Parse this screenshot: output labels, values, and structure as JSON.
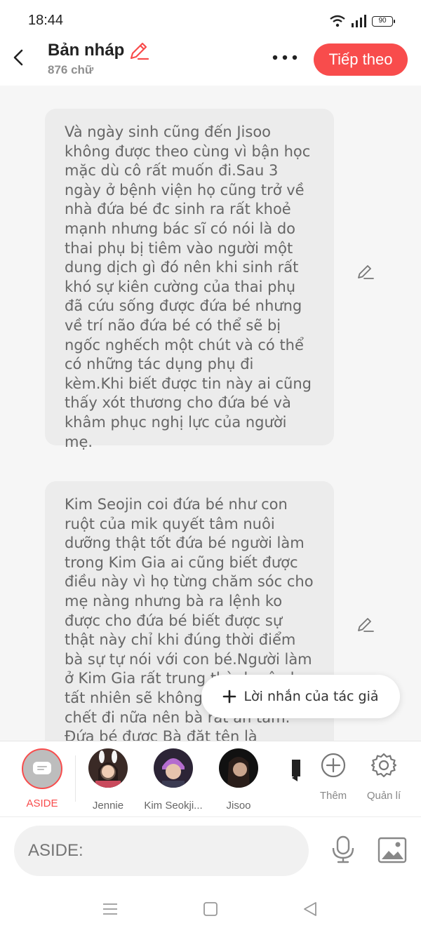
{
  "status_bar": {
    "time": "18:44",
    "battery": "90"
  },
  "header": {
    "title": "Bản nháp",
    "word_count": "876 chữ",
    "next_label": "Tiếp theo"
  },
  "content": {
    "paragraphs": [
      "Và ngày sinh cũng đến Jisoo không được  theo cùng vì bận học mặc dù cô rất muốn đi.Sau 3 ngày ở bệnh viện họ cũng trở về nhà đứa bé đc sinh ra rất khoẻ mạnh nhưng bác sĩ có nói là do thai phụ bị tiêm vào người một dung dịch gì đó nên khi sinh rất khó sự kiên cường của thai phụ đã cứu sống được đứa bé nhưng về trí não đứa bé có thể sẽ bị ngốc nghếch một chút và có thể có những tác dụng phụ đi kèm.Khi biết được tin này ai cũng thấy xót thương cho đứa bé và khâm phục nghị lực của người mẹ.",
      "Kim Seojin coi đứa bé như con ruột của mik quyết tâm nuôi dưỡng thật tốt đứa bé người làm trong Kim Gia ai cũng biết được điều này vì họ từng chăm sóc cho mẹ nàng nhưng bà ra lệnh ko được cho đứa bé biết được sự thật này chỉ khi đúng thời điểm bà sự tự nói với con bé.Người làm ở Kim Gia rất trung thành nên họ tất nhiên sẽ không nói ra dù có chết đi nữa nên bà rất an tâm. Đứa bé được Bà đặt tên là"
    ],
    "author_note_label": "Lời nhắn của tác giả"
  },
  "characters": [
    {
      "name": "ASIDE",
      "selected": true
    },
    {
      "name": "Jennie",
      "selected": false
    },
    {
      "name": "Kim Seokji...",
      "selected": false
    },
    {
      "name": "Jisoo",
      "selected": false
    }
  ],
  "tools": {
    "add_label": "Thêm",
    "manage_label": "Quản lí"
  },
  "composer": {
    "placeholder": "ASIDE:"
  },
  "colors": {
    "accent": "#f84c4c",
    "bubble": "#ececec",
    "background": "#f6f6f6"
  }
}
